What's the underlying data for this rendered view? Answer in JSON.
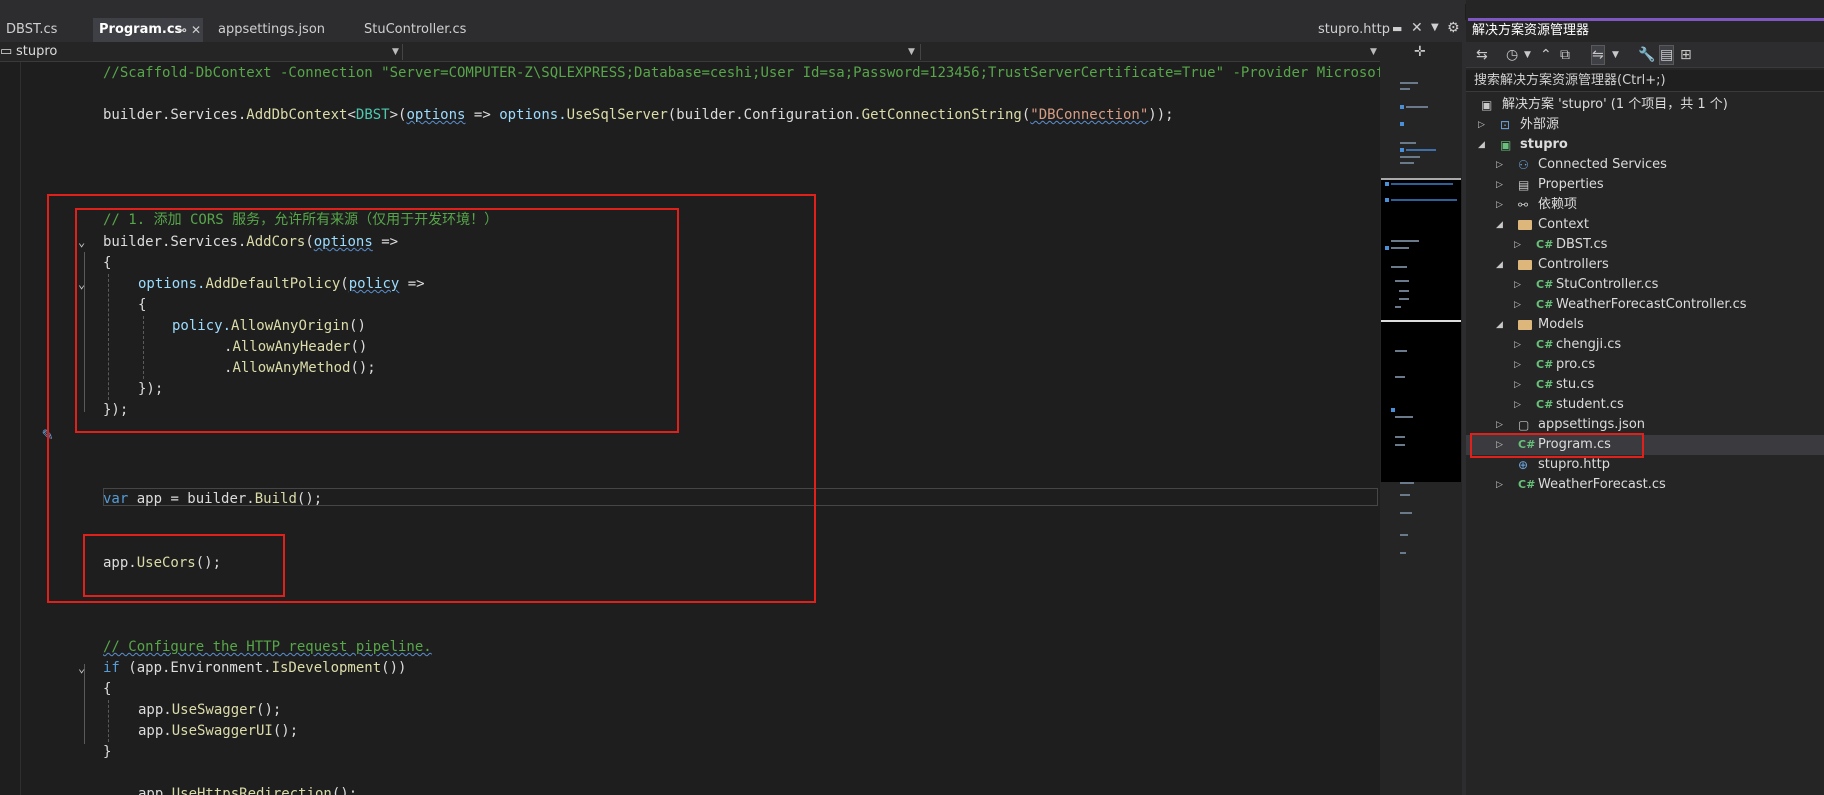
{
  "tabs": [
    {
      "label": "DBST.cs",
      "active": false
    },
    {
      "label": "Program.cs",
      "active": true
    },
    {
      "label": "appsettings.json",
      "active": false
    },
    {
      "label": "StuController.cs",
      "active": false
    }
  ],
  "tab_pin_glyph": "⊸",
  "tab_close_glyph": "✕",
  "right_tab": {
    "label": "stupro.http"
  },
  "nav": {
    "project": "stupro",
    "member": "",
    "scope": ""
  },
  "code": {
    "comment_scaffold": "//Scaffold-DbContext -Connection \"Server=COMPUTER-Z\\SQLEXPRESS;Database=ceshi;User Id=sa;Password=123456;TrustServerCertificate=True\" -Provider Microsoft.EntityFrameworkCore.SqlServer",
    "line_adddb": {
      "p1": "builder.Services.",
      "fn": "AddDbContext",
      "lt": "<",
      "tp": "DBST",
      "gt": ">(",
      "p_opts": "options",
      "arrow": " => ",
      "p2": "options.",
      "fn2": "UseSqlServer",
      "p3": "(builder.Configuration.",
      "fn3": "GetConnectionString",
      "p4": "(",
      "st": "\"DBConnection\"",
      "p5": "));"
    },
    "comment_cors": "// 1. 添加 CORS 服务，允许所有来源（仅用于开发环境！）",
    "addcors": {
      "p1": "builder.Services.",
      "fn": "AddCors",
      "p2": "(",
      "opts": "options",
      "p3": " =>"
    },
    "brace_open": "{",
    "adddefault": {
      "p1": "options.",
      "fn": "AddDefaultPolicy",
      "p2": "(",
      "pol": "policy",
      "p3": " =>"
    },
    "brace_open2": "{",
    "allow_origin": {
      "p1": "policy.",
      "fn": "AllowAnyOrigin",
      "p2": "()"
    },
    "allow_header": {
      "p1": ".",
      "fn": "AllowAnyHeader",
      "p2": "()"
    },
    "allow_method": {
      "p1": ".",
      "fn": "AllowAnyMethod",
      "p2": "();"
    },
    "close_inner": "});",
    "close_outer": "});",
    "var_app": {
      "kw": "var",
      "p1": " app = builder.",
      "fn": "Build",
      "p2": "();"
    },
    "use_cors": {
      "p1": "app.",
      "fn": "UseCors",
      "p2": "();"
    },
    "comment_pipeline": "// Configure the HTTP request pipeline.",
    "if_dev": {
      "kw": "if",
      "p1": " (app.Environment.",
      "fn": "IsDevelopment",
      "p2": "())"
    },
    "brace_open3": "{",
    "swagger": {
      "p1": "app.",
      "fn": "UseSwagger",
      "p2": "();"
    },
    "swaggerui": {
      "p1": "app.",
      "fn": "UseSwaggerUI",
      "p2": "();"
    },
    "brace_close3": "}",
    "https": {
      "p1": "app.",
      "fn": "UseHttpsRedirection",
      "p2": "();"
    }
  },
  "solution_explorer": {
    "title": "解决方案资源管理器",
    "search_placeholder": "搜索解决方案资源管理器(Ctrl+;)",
    "items": [
      {
        "label": "解决方案 'stupro' (1 个项目，共 1 个)",
        "icon": "solution-icon"
      },
      {
        "label": "外部源",
        "icon": "external-sources-icon"
      },
      {
        "label": "stupro",
        "icon": "csharp-project-icon"
      },
      {
        "label": "Connected Services",
        "icon": "connected-services-icon"
      },
      {
        "label": "Properties",
        "icon": "properties-icon"
      },
      {
        "label": "依赖项",
        "icon": "dependencies-icon"
      },
      {
        "label": "Context",
        "icon": "folder-icon"
      },
      {
        "label": "DBST.cs",
        "icon": "csharp-file-icon"
      },
      {
        "label": "Controllers",
        "icon": "folder-icon"
      },
      {
        "label": "StuController.cs",
        "icon": "csharp-file-icon"
      },
      {
        "label": "WeatherForecastController.cs",
        "icon": "csharp-file-icon"
      },
      {
        "label": "Models",
        "icon": "folder-icon"
      },
      {
        "label": "chengji.cs",
        "icon": "csharp-file-icon"
      },
      {
        "label": "pro.cs",
        "icon": "csharp-file-icon"
      },
      {
        "label": "stu.cs",
        "icon": "csharp-file-icon"
      },
      {
        "label": "student.cs",
        "icon": "csharp-file-icon"
      },
      {
        "label": "appsettings.json",
        "icon": "json-file-icon"
      },
      {
        "label": "Program.cs",
        "icon": "csharp-file-icon"
      },
      {
        "label": "stupro.http",
        "icon": "http-file-icon"
      },
      {
        "label": "WeatherForecast.cs",
        "icon": "csharp-file-icon"
      }
    ],
    "cs_glyph": "C#"
  },
  "colors": {
    "highlight_box": "#e0201a",
    "keyword": "#569cd6",
    "type": "#4ec9b0",
    "method": "#dcdcaa",
    "string": "#d69d85",
    "comment": "#57a64a"
  }
}
